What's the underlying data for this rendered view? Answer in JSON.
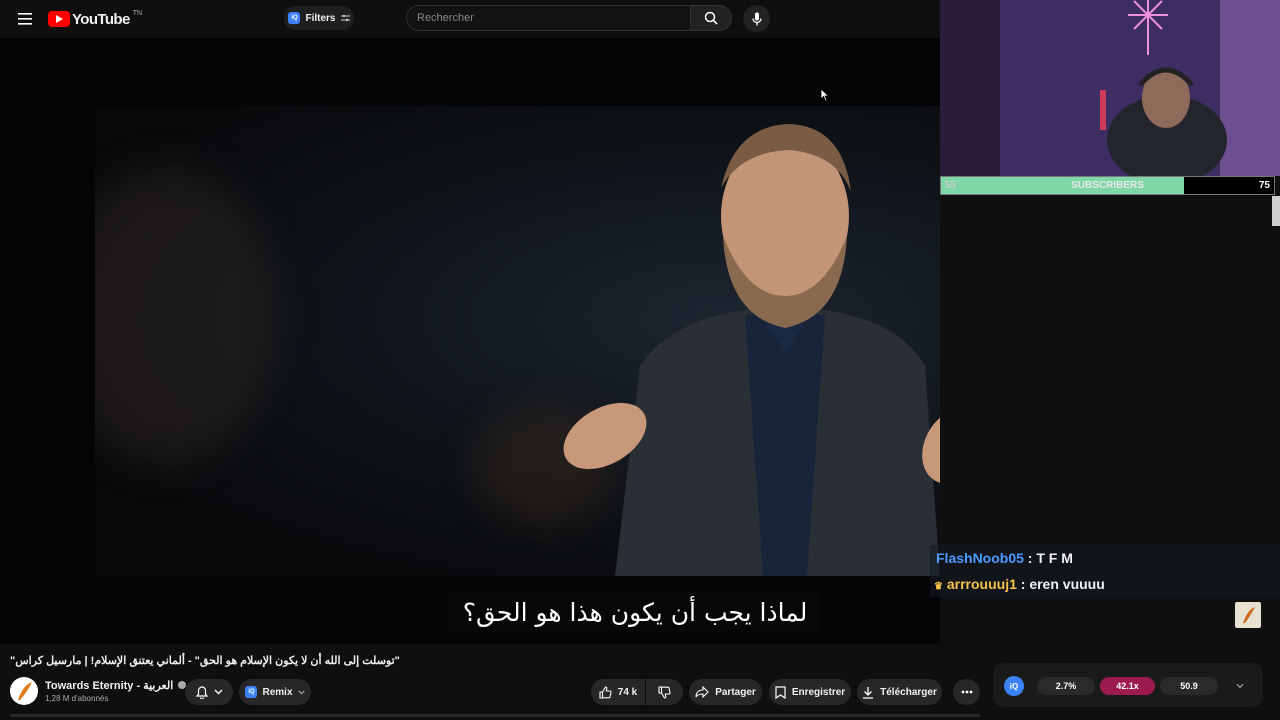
{
  "header": {
    "logo_text": "YouTube",
    "logo_tm": "TN",
    "filters_badge": "iQ",
    "filters_label": "Filters",
    "search_placeholder": "Rechercher"
  },
  "video": {
    "subtitle": "لماذا يجب أن يكون هذا هو الحق؟"
  },
  "overlay": {
    "subscriber_goal": {
      "current": "55",
      "label": "SUBSCRIBERS",
      "target": "75",
      "progress_fraction": 0.73
    },
    "chat": [
      {
        "user": "FlashNoob05",
        "message": " : T F M"
      },
      {
        "user": "arrrouuuj1",
        "message": " : eren vuuuu"
      }
    ]
  },
  "info": {
    "title": "\"توسلت إلى الله أن لا يكون الإسلام هو الحق\" - ألماني يعتنق الإسلام! | مارسيل كراس\"",
    "channel_name": "Towards Eternity - العربية",
    "channel_subs": "1,28 M d'abonnés",
    "remix_badge": "iQ",
    "remix_label": "Remix",
    "like_count": "74 k",
    "share_label": "Partager",
    "save_label": "Enregistrer",
    "download_label": "Télécharger"
  },
  "stats": {
    "badge": "iQ",
    "values": [
      "2.7%",
      "42.1x",
      "50.9"
    ],
    "colors": [
      "#2a2a2a",
      "#9c1a4e",
      "#2a2a2a"
    ]
  }
}
